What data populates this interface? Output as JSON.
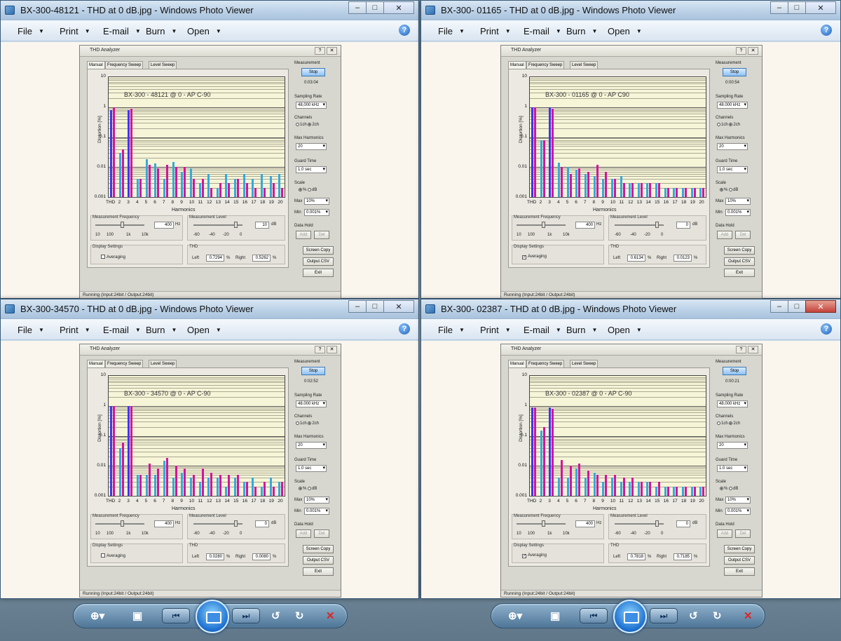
{
  "windows": [
    {
      "title": "BX-300-48121 - THD at 0 dB.jpg - Windows Photo Viewer",
      "menu": [
        "File",
        "Print",
        "E-mail",
        "Burn",
        "Open"
      ],
      "analyzer": {
        "title": "THD Analyzer",
        "tabs": [
          "Manual",
          "Frequency Sweep",
          "Level Sweep"
        ],
        "plot_title": "BX-300 - 48121 @ 0 - AP C-90",
        "time": "0:03:04",
        "sampling_rate": "48,000 kHz",
        "thd_left": "0.7294",
        "thd_right": "0.5262",
        "averaging": false,
        "freq": "400",
        "level": "10"
      }
    },
    {
      "title": "BX-300- 01165 - THD at 0 dB.jpg - Windows Photo Viewer",
      "menu": [
        "File",
        "Print",
        "E-mail",
        "Burn",
        "Open"
      ],
      "analyzer": {
        "title": "THD Analyzer",
        "tabs": [
          "Manual",
          "Frequency Sweep",
          "Level Sweep"
        ],
        "plot_title": "BX-300 - 01165 @ 0 - AP C90",
        "time": "0:00:54",
        "sampling_rate": "48.000 kHz",
        "thd_left": "0.6134",
        "thd_right": "0.0123",
        "averaging": true,
        "freq": "400",
        "level": "0"
      }
    },
    {
      "title": "BX-300-34570 - THD at 0 dB.jpg - Windows Photo Viewer",
      "menu": [
        "File",
        "Print",
        "E-mail",
        "Burn",
        "Open"
      ],
      "analyzer": {
        "title": "THD Analyzer",
        "tabs": [
          "Manual",
          "Frequency Sweep",
          "Level Sweep"
        ],
        "plot_title": "BX-300 - 34570 @ 0 - AP C-90",
        "time": "0:02:52",
        "sampling_rate": "48.000 kHz",
        "thd_left": "0.0280",
        "thd_right": "0.0080",
        "averaging": false,
        "freq": "400",
        "level": "0"
      }
    },
    {
      "title": "BX-300- 02387 - THD at 0 dB.jpg - Windows Photo Viewer",
      "menu": [
        "File",
        "Print",
        "E-mail",
        "Burn",
        "Open"
      ],
      "analyzer": {
        "title": "THD Analyzer",
        "tabs": [
          "Manual",
          "Frequency Sweep",
          "Level Sweep"
        ],
        "plot_title": "BX-300 - 02387 @ 0 - AP C-90",
        "time": "0:00:21",
        "sampling_rate": "48.000 kHz",
        "thd_left": "0.7818",
        "thd_right": "0.7185",
        "averaging": true,
        "freq": "400",
        "level": "0"
      }
    }
  ],
  "labels": {
    "measurement": "Measurement",
    "stop": "Stop",
    "sampling_rate": "Sampling Rate",
    "channels": "Channels",
    "ch1": "1ch",
    "ch2": "2ch",
    "max_harmonics": "Max Harmonics",
    "max_harmonics_value": "20",
    "guard_time": "Guard Time",
    "guard_time_value": "1.0 sec",
    "scale": "Scale",
    "pct": "%",
    "db": "dB",
    "max": "Max",
    "max_value": "10%",
    "min": "Min",
    "min_value": "0.001%",
    "data_hold": "Data Hold",
    "add": "Add",
    "del": "Del",
    "screen_copy": "Screen Copy",
    "output_csv": "Output CSV",
    "exit": "Exit",
    "meas_freq": "Measurement Frequency",
    "meas_level": "Measurement Level",
    "hz": "Hz",
    "db_unit": "dB",
    "freq_ticks": [
      "10",
      "100",
      "1k",
      "10k"
    ],
    "level_ticks": [
      "-60",
      "-40",
      "-20",
      "0"
    ],
    "display_settings": "Display Settings",
    "averaging": "Averaging",
    "thd": "THD",
    "left": "Left",
    "right": "Right",
    "y_label": "Distortion [%]",
    "x_label": "Harmonics",
    "y_ticks": [
      "10",
      "1",
      "0.1",
      "0.01",
      "0.001"
    ],
    "x_ticks": [
      "THD",
      "2",
      "3",
      "4",
      "5",
      "6",
      "7",
      "8",
      "9",
      "10",
      "11",
      "12",
      "13",
      "14",
      "15",
      "16",
      "17",
      "18",
      "19",
      "20"
    ],
    "status": "Running (Input:24bit / Output:24bit)"
  },
  "chart_data": [
    {
      "type": "bar",
      "title": "BX-300 - 48121 @ 0 - AP C-90",
      "xlabel": "Harmonics",
      "ylabel": "Distortion [%]",
      "scale": "log",
      "ylim": [
        0.001,
        10
      ],
      "categories": [
        "THD",
        "2",
        "3",
        "4",
        "5",
        "6",
        "7",
        "8",
        "9",
        "10",
        "11",
        "12",
        "13",
        "14",
        "15",
        "16",
        "17",
        "18",
        "19",
        "20"
      ],
      "series": [
        {
          "values": [
            0.8,
            0.03,
            0.8,
            0.004,
            0.018,
            0.013,
            0.004,
            0.015,
            0.007,
            0.009,
            0.003,
            0.006,
            0.002,
            0.006,
            0.004,
            0.006,
            0.004,
            0.006,
            0.005,
            0.006
          ]
        },
        {
          "values": [
            1.0,
            0.04,
            0.9,
            0.004,
            0.012,
            0.009,
            0.012,
            0.01,
            0.01,
            0.004,
            0.004,
            0.002,
            0.003,
            0.003,
            0.004,
            0.003,
            0.002,
            0.002,
            0.003,
            0.002
          ]
        }
      ]
    },
    {
      "type": "bar",
      "title": "BX-300 - 01165 @ 0 - AP C90",
      "xlabel": "Harmonics",
      "ylabel": "Distortion [%]",
      "scale": "log",
      "ylim": [
        0.001,
        10
      ],
      "categories": [
        "THD",
        "2",
        "3",
        "4",
        "5",
        "6",
        "7",
        "8",
        "9",
        "10",
        "11",
        "12",
        "13",
        "14",
        "15",
        "16",
        "17",
        "18",
        "19",
        "20"
      ],
      "series": [
        {
          "values": [
            1.0,
            0.08,
            1.0,
            0.014,
            0.01,
            0.008,
            0.006,
            0.005,
            0.004,
            0.004,
            0.005,
            0.003,
            0.003,
            0.003,
            0.003,
            0.002,
            0.002,
            0.002,
            0.002,
            0.002
          ]
        },
        {
          "values": [
            1.0,
            0.08,
            0.9,
            0.01,
            0.006,
            0.009,
            0.007,
            0.012,
            0.007,
            0.004,
            0.003,
            0.003,
            0.003,
            0.003,
            0.003,
            0.002,
            0.002,
            0.002,
            0.002,
            0.002
          ]
        }
      ]
    },
    {
      "type": "bar",
      "title": "BX-300 - 34570 @ 0 - AP C-90",
      "xlabel": "Harmonics",
      "ylabel": "Distortion [%]",
      "scale": "log",
      "ylim": [
        0.001,
        10
      ],
      "categories": [
        "THD",
        "2",
        "3",
        "4",
        "5",
        "6",
        "7",
        "8",
        "9",
        "10",
        "11",
        "12",
        "13",
        "14",
        "15",
        "16",
        "17",
        "18",
        "19",
        "20"
      ],
      "series": [
        {
          "values": [
            1.0,
            0.04,
            1.0,
            0.005,
            0.005,
            0.005,
            0.015,
            0.004,
            0.006,
            0.004,
            0.003,
            0.004,
            0.004,
            0.002,
            0.004,
            0.003,
            0.004,
            0.002,
            0.004,
            0.003
          ]
        },
        {
          "values": [
            1.0,
            0.06,
            1.0,
            0.005,
            0.012,
            0.008,
            0.018,
            0.01,
            0.008,
            0.005,
            0.008,
            0.006,
            0.005,
            0.005,
            0.005,
            0.003,
            0.002,
            0.003,
            0.002,
            0.003
          ]
        }
      ]
    },
    {
      "type": "bar",
      "title": "BX-300 - 02387 @ 0 - AP C-90",
      "xlabel": "Harmonics",
      "ylabel": "Distortion [%]",
      "scale": "log",
      "ylim": [
        0.001,
        10
      ],
      "categories": [
        "THD",
        "2",
        "3",
        "4",
        "5",
        "6",
        "7",
        "8",
        "9",
        "10",
        "11",
        "12",
        "13",
        "14",
        "15",
        "16",
        "17",
        "18",
        "19",
        "20"
      ],
      "series": [
        {
          "values": [
            0.9,
            0.15,
            0.9,
            0.004,
            0.004,
            0.008,
            0.004,
            0.006,
            0.003,
            0.004,
            0.003,
            0.003,
            0.003,
            0.003,
            0.002,
            0.002,
            0.002,
            0.002,
            0.002,
            0.002
          ]
        },
        {
          "values": [
            0.9,
            0.2,
            0.8,
            0.016,
            0.01,
            0.012,
            0.007,
            0.005,
            0.005,
            0.005,
            0.004,
            0.004,
            0.003,
            0.003,
            0.003,
            0.002,
            0.002,
            0.002,
            0.002,
            0.002
          ]
        }
      ]
    }
  ],
  "taskbar": {
    "buttons": [
      "zoom-icon",
      "fit-icon",
      "prev-icon",
      "slideshow-icon",
      "next-icon",
      "rotate-ccw-icon",
      "rotate-cw-icon",
      "delete-icon"
    ]
  }
}
